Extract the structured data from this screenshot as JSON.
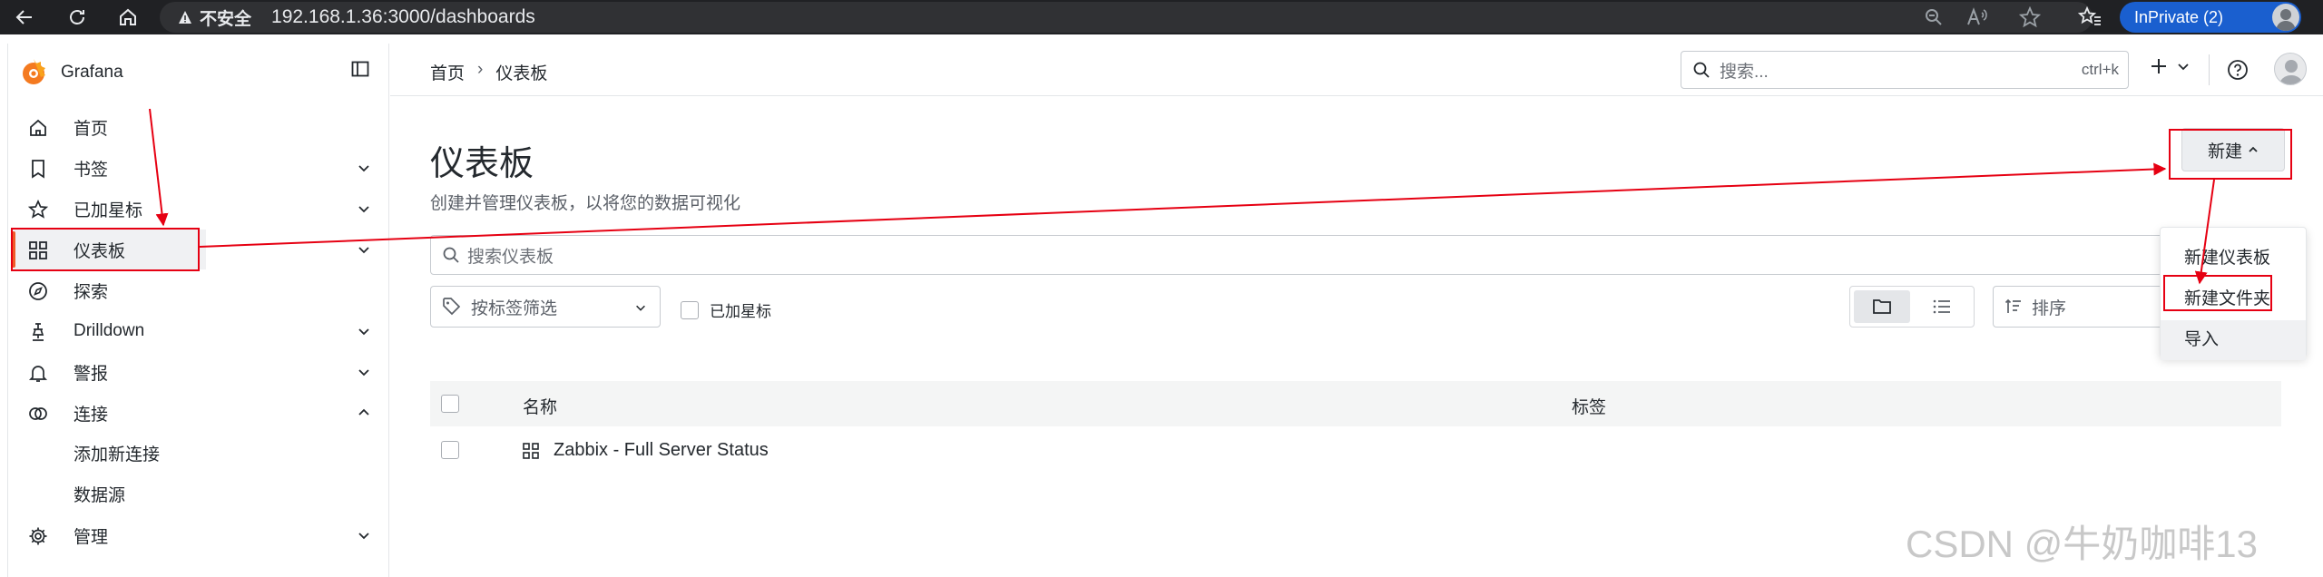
{
  "browser": {
    "insecure_label": "不安全",
    "url": "192.168.1.36:3000/dashboards",
    "inprivate_label": "InPrivate (2)"
  },
  "sidebar": {
    "brand": "Grafana",
    "items": [
      {
        "label": "首页"
      },
      {
        "label": "书签"
      },
      {
        "label": "已加星标"
      },
      {
        "label": "仪表板"
      },
      {
        "label": "探索"
      },
      {
        "label": "Drilldown"
      },
      {
        "label": "警报"
      },
      {
        "label": "连接"
      },
      {
        "label": "添加新连接"
      },
      {
        "label": "数据源"
      },
      {
        "label": "管理"
      }
    ]
  },
  "topbar": {
    "breadcrumb_home": "首页",
    "breadcrumb_sep": "›",
    "breadcrumb_current": "仪表板",
    "search_placeholder": "搜索...",
    "search_shortcut": "ctrl+k"
  },
  "main": {
    "title": "仪表板",
    "description": "创建并管理仪表板，以将您的数据可视化",
    "new_button": "新建",
    "filter_placeholder": "搜索仪表板",
    "tag_filter": "按标签筛选",
    "starred_filter": "已加星标",
    "sort": "排序",
    "columns": {
      "name": "名称",
      "tags": "标签"
    },
    "rows": [
      {
        "title": "Zabbix - Full Server Status"
      }
    ]
  },
  "new_menu": {
    "items": [
      {
        "label": "新建仪表板"
      },
      {
        "label": "新建文件夹"
      },
      {
        "label": "导入"
      }
    ]
  },
  "watermark": "CSDN @牛奶咖啡13",
  "colors": {
    "annotation": "#e60012",
    "grafana_orange": "#f05a28"
  }
}
